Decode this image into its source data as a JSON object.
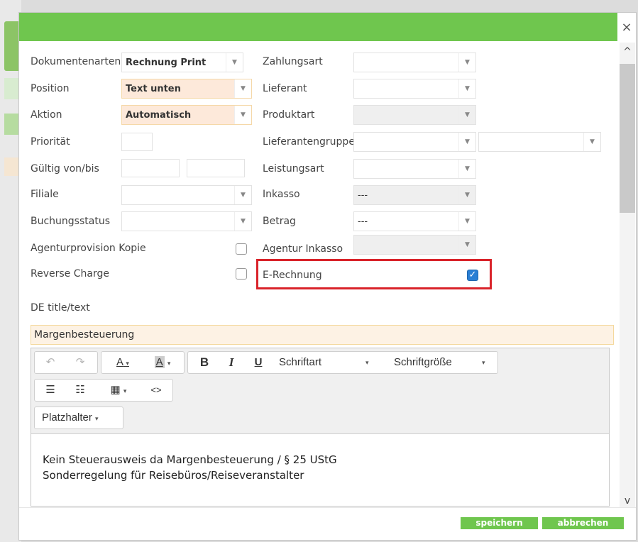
{
  "dialog": {
    "close_icon": "×",
    "colors": {
      "accent": "#6fc64e",
      "highlight_border": "#d9232a",
      "checkbox_checked": "#2a7fd4"
    }
  },
  "scrollbar": {
    "up_icon": "^",
    "down_icon": "v"
  },
  "left_fields": [
    {
      "label": "Dokumentenarten",
      "value": "Rechnung Print"
    },
    {
      "label": "Position",
      "value": "Text unten"
    },
    {
      "label": "Aktion",
      "value": "Automatisch"
    },
    {
      "label": "Priorität",
      "value": ""
    },
    {
      "label": "Gültig von/bis",
      "value": ""
    },
    {
      "label": "Filiale",
      "value": ""
    },
    {
      "label": "Buchungsstatus",
      "value": ""
    },
    {
      "label": "Agenturprovision Kopie",
      "checked": false
    },
    {
      "label": "Reverse Charge",
      "checked": false
    }
  ],
  "right_fields": [
    {
      "label": "Zahlungsart",
      "value": ""
    },
    {
      "label": "Lieferant",
      "value": ""
    },
    {
      "label": "Produktart",
      "value": ""
    },
    {
      "label": "Lieferantengruppe",
      "value": ""
    },
    {
      "label": "Leistungsart",
      "value": ""
    },
    {
      "label": "Inkasso",
      "value": "---"
    },
    {
      "label": "Betrag",
      "value": "---"
    },
    {
      "label": "Agentur Inkasso",
      "value": ""
    },
    {
      "label": "E-Rechnung",
      "checked": true
    }
  ],
  "text_section": {
    "label": "DE title/text",
    "title_value": "Margenbesteuerung"
  },
  "editor": {
    "toolbar": {
      "undo_icon": "↶",
      "redo_icon": "↷",
      "font_color_label": "A",
      "highlight_label": "A",
      "bold_label": "B",
      "italic_label": "I",
      "underline_label": "U",
      "font_family_label": "Schriftart",
      "font_size_label": "Schriftgröße",
      "bullet_list_icon": "☰",
      "numbered_list_icon": "☷",
      "table_icon": "▦",
      "code_icon": "<>",
      "placeholder_label": "Platzhalter",
      "dropdown_icon": "▾"
    },
    "body_lines": [
      "Kein Steuerausweis da Margenbesteuerung / § 25 UStG",
      "Sonderregelung für Reisebüros/Reiseveranstalter"
    ]
  },
  "footer": {
    "save_label": "speichern",
    "cancel_label": "abbrechen"
  }
}
